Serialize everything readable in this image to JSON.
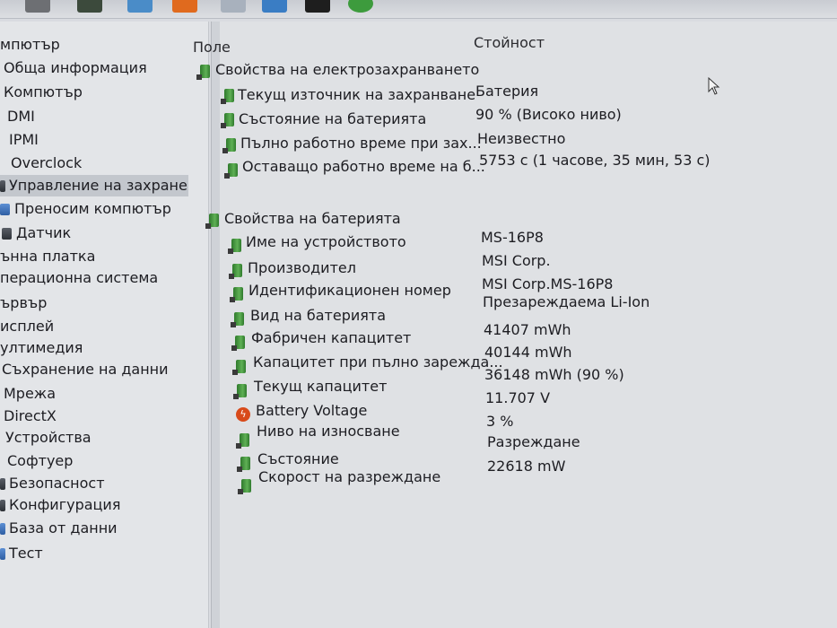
{
  "sidebar": {
    "items": [
      {
        "label": "мпютър",
        "icon": "computer-icon"
      },
      {
        "label": "Обща информация",
        "icon": "info-icon"
      },
      {
        "label": "Компютър",
        "icon": "computer-icon"
      },
      {
        "label": "DMI",
        "icon": "chip-icon"
      },
      {
        "label": "IPMI",
        "icon": "chip-icon"
      },
      {
        "label": "Overclock",
        "icon": "overclock-icon"
      },
      {
        "label": "Управление на захране",
        "icon": "power-icon",
        "selected": true
      },
      {
        "label": "Преносим компютър",
        "icon": "laptop-icon"
      },
      {
        "label": "Датчик",
        "icon": "sensor-icon"
      },
      {
        "label": "ънна платка",
        "icon": "motherboard-icon"
      },
      {
        "label": "перационна система",
        "icon": "os-icon"
      },
      {
        "label": "ървър",
        "icon": "server-icon"
      },
      {
        "label": "исплей",
        "icon": "display-icon"
      },
      {
        "label": "ултимедия",
        "icon": "multimedia-icon"
      },
      {
        "label": "Съхранение на данни",
        "icon": "storage-icon"
      },
      {
        "label": "Мрежа",
        "icon": "network-icon"
      },
      {
        "label": "DirectX",
        "icon": "directx-icon"
      },
      {
        "label": "Устройства",
        "icon": "devices-icon"
      },
      {
        "label": "Софтуер",
        "icon": "software-icon"
      },
      {
        "label": "Безопасност",
        "icon": "security-icon"
      },
      {
        "label": "Конфигурация",
        "icon": "config-icon"
      },
      {
        "label": "База от данни",
        "icon": "database-icon"
      },
      {
        "label": "Тест",
        "icon": "test-icon"
      }
    ]
  },
  "columns": {
    "field": "Поле",
    "value": "Стойност"
  },
  "power_section": {
    "title": "Свойства на електрозахранването",
    "rows": [
      {
        "label": "Текущ източник на захранване",
        "value": "Батерия"
      },
      {
        "label": "Състояние на батерията",
        "value": "90 % (Високо ниво)"
      },
      {
        "label": "Пълно работно време при зах...",
        "value": "Неизвестно"
      },
      {
        "label": "Оставащо работно време на б...",
        "value": "5753 с (1 часове, 35 мин, 53 с)"
      }
    ]
  },
  "battery_section": {
    "title": "Свойства на батерията",
    "rows": [
      {
        "label": "Име на устройството",
        "value": "MS-16P8"
      },
      {
        "label": "Производител",
        "value": "MSI Corp."
      },
      {
        "label": "Идентификационен номер",
        "value": "MSI Corp.MS-16P8"
      },
      {
        "label": "Вид на батерията",
        "value": "Презареждаема Li-Ion"
      },
      {
        "label": "Фабричен капацитет",
        "value": "41407 mWh"
      },
      {
        "label": "Капацитет при пълно зарежда...",
        "value": "40144 mWh"
      },
      {
        "label": "Текущ капацитет",
        "value": "36148 mWh  (90 %)"
      },
      {
        "label": "Battery Voltage",
        "value": "11.707 V",
        "icon": "voltage-icon"
      },
      {
        "label": "Ниво на износване",
        "value": "3 %"
      },
      {
        "label": "Състояние",
        "value": "Разреждане"
      },
      {
        "label": "Скорост на разреждане",
        "value": "22618 mW"
      }
    ]
  },
  "colors": {
    "battery_icon": "#3f8f3a",
    "voltage_icon": "#d84a1a",
    "selection": "#c3c7cd"
  }
}
